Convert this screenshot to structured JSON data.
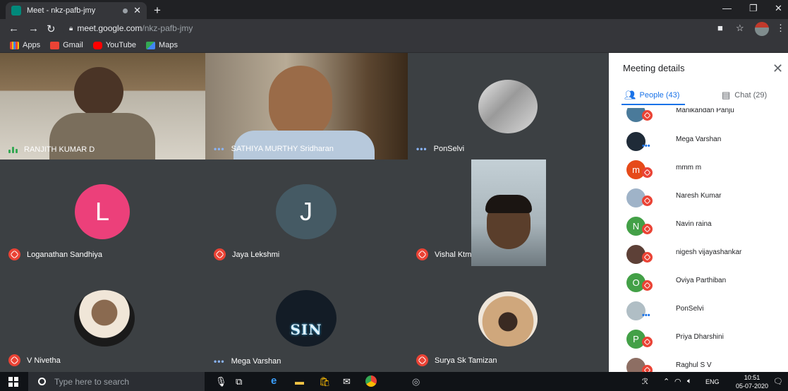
{
  "browser": {
    "tab_title": "Meet - nkz-pafb-jmy",
    "url_host": "meet.google.com",
    "url_path": "/nkz-pafb-jmy",
    "bookmarks": [
      {
        "label": "Apps",
        "color": "#ea4335"
      },
      {
        "label": "Gmail",
        "color": "#ea4335"
      },
      {
        "label": "YouTube",
        "color": "#ff0000"
      },
      {
        "label": "Maps",
        "color": "#34a853"
      }
    ]
  },
  "tiles": [
    {
      "name": "RANJITH KUMAR D",
      "status": "speaking"
    },
    {
      "name": "SATHIYA MURTHY Sridharan",
      "status": "dots"
    },
    {
      "name": "PonSelvi",
      "status": "dots"
    },
    {
      "name": "Loganathan Sandhiya",
      "status": "muted",
      "initial": "L",
      "color": "#ec407a"
    },
    {
      "name": "Jaya Lekshmi",
      "status": "muted",
      "initial": "J",
      "color": "#455a64"
    },
    {
      "name": "Vishal Ktm",
      "status": "muted"
    },
    {
      "name": "V Nivetha",
      "status": "muted"
    },
    {
      "name": "Mega Varshan",
      "status": "dots",
      "logo_text": "SIN"
    },
    {
      "name": "Surya Sk Tamizan",
      "status": "muted"
    }
  ],
  "panel": {
    "title": "Meeting details",
    "people_tab": "People (43)",
    "chat_tab": "Chat (29)",
    "people": [
      {
        "name": "Manikandan Panju",
        "initial": "",
        "color": "#4a7a9a",
        "status": "muted"
      },
      {
        "name": "Mega Varshan",
        "initial": "",
        "color": "#1f2b38",
        "status": "dots"
      },
      {
        "name": "mmm m",
        "initial": "m",
        "color": "#e64a19",
        "status": "muted"
      },
      {
        "name": "Naresh Kumar",
        "initial": "",
        "color": "#9fb3c8",
        "status": "muted"
      },
      {
        "name": "Navin raina",
        "initial": "N",
        "color": "#43a047",
        "status": "muted"
      },
      {
        "name": "nigesh vijayashankar",
        "initial": "",
        "color": "#5d4037",
        "status": "muted"
      },
      {
        "name": "Oviya Parthiban",
        "initial": "O",
        "color": "#43a047",
        "status": "muted"
      },
      {
        "name": "PonSelvi",
        "initial": "",
        "color": "#b0bec5",
        "status": "dots"
      },
      {
        "name": "Priya Dharshini",
        "initial": "P",
        "color": "#43a047",
        "status": "muted"
      },
      {
        "name": "Raghul S V",
        "initial": "",
        "color": "#8d6e63",
        "status": "muted"
      }
    ]
  },
  "taskbar": {
    "search_placeholder": "Type here to search",
    "lang": "ENG",
    "time": "10:51",
    "date": "05-07-2020"
  }
}
